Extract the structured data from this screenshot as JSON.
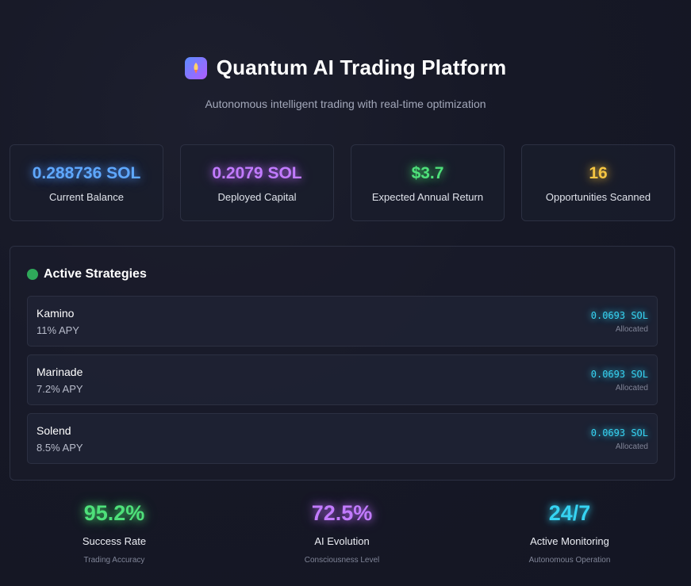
{
  "header": {
    "title": "Quantum AI Trading Platform",
    "subtitle": "Autonomous intelligent trading with real-time optimization",
    "logo_icon": "rocket-icon"
  },
  "stats": [
    {
      "value": "0.288736 SOL",
      "label": "Current Balance",
      "color": "#5fa8ff"
    },
    {
      "value": "0.2079 SOL",
      "label": "Deployed Capital",
      "color": "#c27bff"
    },
    {
      "value": "$3.7",
      "label": "Expected Annual Return",
      "color": "#4ee07a"
    },
    {
      "value": "16",
      "label": "Opportunities Scanned",
      "color": "#f5c542"
    }
  ],
  "strategies": {
    "title": "Active Strategies",
    "status_color": "#2fa85a",
    "items": [
      {
        "name": "Kamino",
        "apy": "11% APY",
        "amount": "0.0693 SOL",
        "allocated_label": "Allocated"
      },
      {
        "name": "Marinade",
        "apy": "7.2% APY",
        "amount": "0.0693 SOL",
        "allocated_label": "Allocated"
      },
      {
        "name": "Solend",
        "apy": "8.5% APY",
        "amount": "0.0693 SOL",
        "allocated_label": "Allocated"
      }
    ]
  },
  "metrics": [
    {
      "value": "95.2%",
      "label": "Success Rate",
      "sub": "Trading Accuracy",
      "color": "#4ee07a"
    },
    {
      "value": "72.5%",
      "label": "AI Evolution",
      "sub": "Consciousness Level",
      "color": "#c27bff"
    },
    {
      "value": "24/7",
      "label": "Active Monitoring",
      "sub": "Autonomous Operation",
      "color": "#36d3f2"
    }
  ]
}
